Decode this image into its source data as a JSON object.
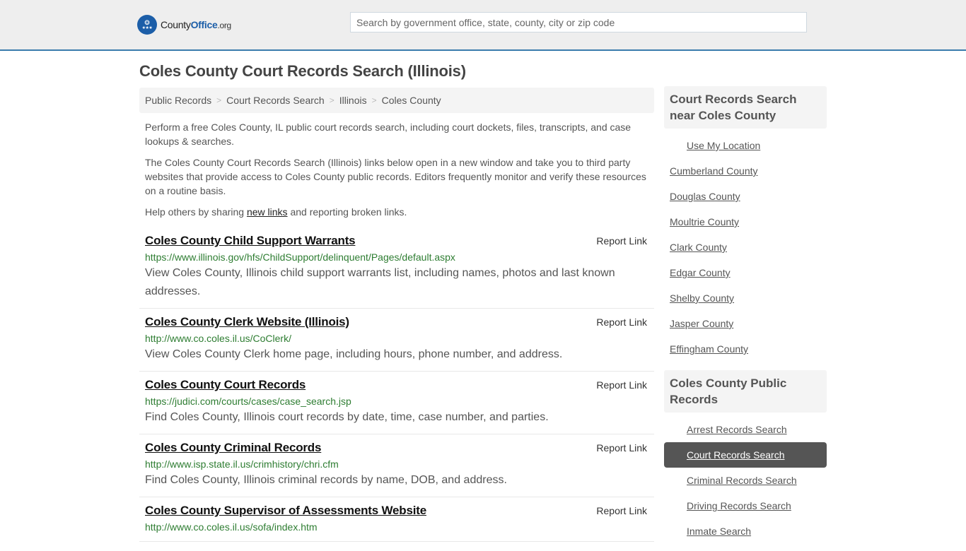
{
  "header": {
    "logo": {
      "prefix": "County",
      "brand": "Office",
      "tld": ".org",
      "icon": "eagle-stars-icon"
    },
    "search": {
      "placeholder": "Search by government office, state, county, city or zip code",
      "value": ""
    }
  },
  "page_title": "Coles County Court Records Search (Illinois)",
  "breadcrumb": [
    "Public Records",
    "Court Records Search",
    "Illinois",
    "Coles County"
  ],
  "intro": {
    "p1": "Perform a free Coles County, IL public court records search, including court dockets, files, transcripts, and case lookups & searches.",
    "p2": "The Coles County Court Records Search (Illinois) links below open in a new window and take you to third party websites that provide access to Coles County public records. Editors frequently monitor and verify these resources on a routine basis.",
    "p3_before": "Help others by sharing ",
    "p3_link": "new links",
    "p3_after": " and reporting broken links."
  },
  "report_label": "Report Link",
  "results": [
    {
      "title": "Coles County Child Support Warrants",
      "url": "https://www.illinois.gov/hfs/ChildSupport/delinquent/Pages/default.aspx",
      "desc": "View Coles County, Illinois child support warrants list, including names, photos and last known addresses."
    },
    {
      "title": "Coles County Clerk Website (Illinois)",
      "url": "http://www.co.coles.il.us/CoClerk/",
      "desc": "View Coles County Clerk home page, including hours, phone number, and address."
    },
    {
      "title": "Coles County Court Records",
      "url": "https://judici.com/courts/cases/case_search.jsp",
      "desc": "Find Coles County, Illinois court records by date, time, case number, and parties."
    },
    {
      "title": "Coles County Criminal Records",
      "url": "http://www.isp.state.il.us/crimhistory/chri.cfm",
      "desc": "Find Coles County, Illinois criminal records by name, DOB, and address."
    },
    {
      "title": "Coles County Supervisor of Assessments Website",
      "url": "http://www.co.coles.il.us/sofa/index.htm",
      "desc": ""
    }
  ],
  "sidebar": {
    "nearby": {
      "heading": "Court Records Search near Coles County",
      "use_location": "Use My Location",
      "items": [
        "Cumberland County",
        "Douglas County",
        "Moultrie County",
        "Clark County",
        "Edgar County",
        "Shelby County",
        "Jasper County",
        "Effingham County"
      ]
    },
    "public_records": {
      "heading": "Coles County Public Records",
      "items": [
        "Arrest Records Search",
        "Court Records Search",
        "Criminal Records Search",
        "Driving Records Search",
        "Inmate Search"
      ],
      "active": "Court Records Search"
    }
  },
  "colors": {
    "accent": "#3a7cad",
    "brand": "#1c5ea8",
    "url_green": "#2e7d32",
    "active_bg": "#555555"
  }
}
